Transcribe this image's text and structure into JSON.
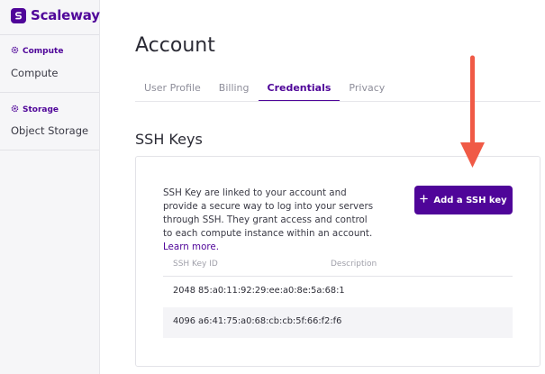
{
  "brand": {
    "name": "Scaleway",
    "color": "#4f0599"
  },
  "sidebar": {
    "sections": [
      {
        "heading": "Compute",
        "icon": "gear-icon",
        "item": "Compute"
      },
      {
        "heading": "Storage",
        "icon": "gear-icon",
        "item": "Object Storage"
      }
    ]
  },
  "page": {
    "title": "Account"
  },
  "tabs": [
    {
      "label": "User Profile",
      "active": false
    },
    {
      "label": "Billing",
      "active": false
    },
    {
      "label": "Credentials",
      "active": true
    },
    {
      "label": "Privacy",
      "active": false
    }
  ],
  "ssh": {
    "title": "SSH Keys",
    "description": "SSH Key are linked to your account and provide a secure way to log into your servers through SSH. They grant access and control to each compute instance within an account.",
    "learn_more": "Learn more.",
    "add_button": "Add a SSH key",
    "add_icon": "plus-icon",
    "columns": [
      "SSH Key ID",
      "Description"
    ],
    "keys": [
      {
        "id": "2048 85:a0:11:92:29:ee:a0:8e:5a:68:1",
        "description": ""
      },
      {
        "id": "4096 a6:41:75:a0:68:cb:cb:5f:66:f2:f6",
        "description": ""
      }
    ]
  },
  "annotation": {
    "arrow_color": "#f05a46"
  }
}
